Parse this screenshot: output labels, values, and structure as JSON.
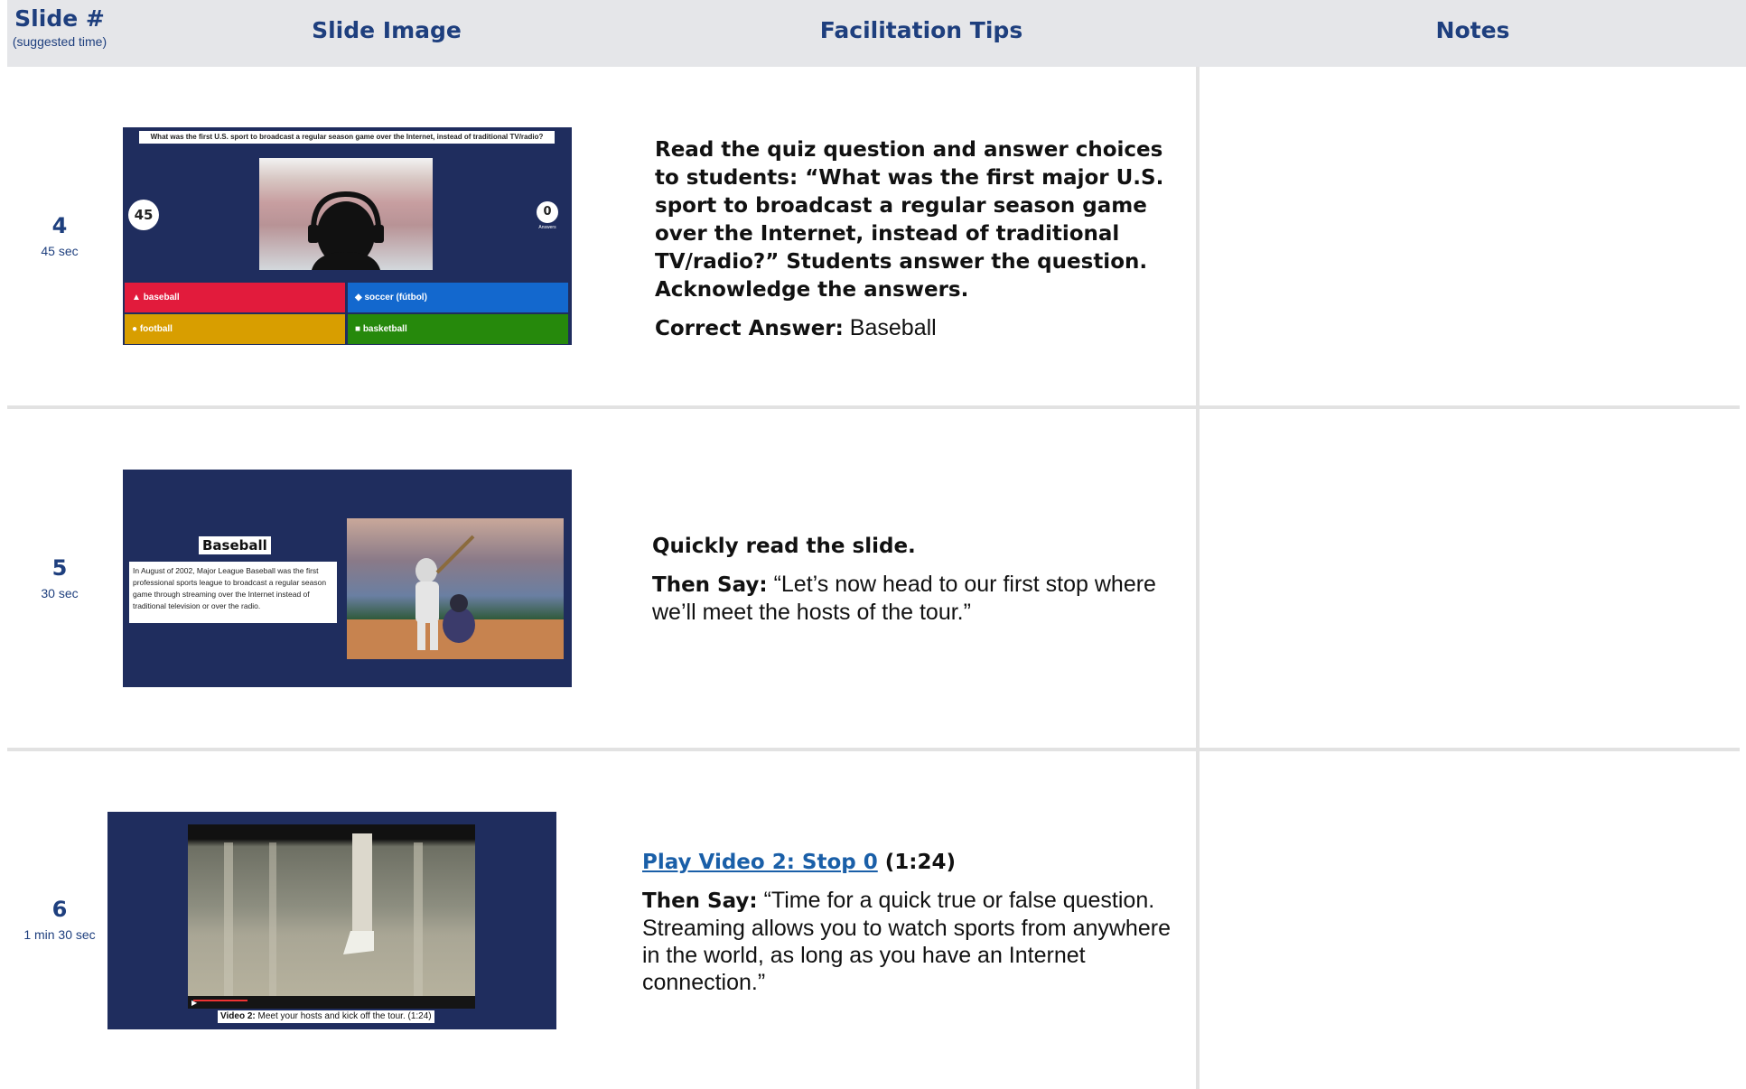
{
  "header": {
    "slide_num_title": "Slide #",
    "slide_num_sub": "(suggested time)",
    "slide_image": "Slide Image",
    "facilitation_tips": "Facilitation Tips",
    "notes": "Notes"
  },
  "rows": [
    {
      "num": "4",
      "time": "45 sec",
      "slide": {
        "question": "What was the first U.S. sport to broadcast a regular season game over the Internet, instead of traditional TV/radio?",
        "timer": "45",
        "answers_count": "0",
        "answers_label": "Answers",
        "choices": [
          "baseball",
          "soccer (fútbol)",
          "football",
          "basketball"
        ]
      },
      "tips_line1": "Read the quiz question and answer choices to students: “What was the first major U.S. sport to broadcast a regular season game over the Internet, instead of traditional TV/radio?” Students answer the question. Acknowledge the answers.",
      "tips_correct_label": "Correct Answer:",
      "tips_correct_value": " Baseball"
    },
    {
      "num": "5",
      "time": "30 sec",
      "slide": {
        "title": "Baseball",
        "body": "In August of 2002, Major League Baseball was the first professional sports league to broadcast a regular season game through streaming over the Internet instead of traditional television or over the radio."
      },
      "tips_line1": "Quickly read the slide.",
      "tips_say_label": "Then Say:",
      "tips_say_text": " “Let’s now head to our first stop where we’ll meet the hosts of the tour.”"
    },
    {
      "num": "6",
      "time": "1 min 30 sec",
      "slide": {
        "caption_bold": "Video 2:",
        "caption_text": " Meet your hosts and kick off the tour. (1:24)"
      },
      "tips_link": "Play Video 2: Stop 0",
      "tips_duration": " (1:24)",
      "tips_say_label": "Then Say:",
      "tips_say_text": " “Time for a quick true or false question. Streaming allows you to watch sports from anywhere in the world, as long as you have an Internet connection.”"
    }
  ],
  "colors": {
    "header_bg": "#e5e6e9",
    "header_text": "#1e3f7e",
    "slide_bg": "#1f2d5e",
    "red": "#e21b3c",
    "blue": "#1368ce",
    "yellow": "#d89e00",
    "green": "#26890c",
    "link": "#1a5fa8"
  },
  "icons": [
    "triangle-icon",
    "diamond-icon",
    "circle-icon",
    "square-icon",
    "headphones-silhouette-icon",
    "play-icon"
  ]
}
